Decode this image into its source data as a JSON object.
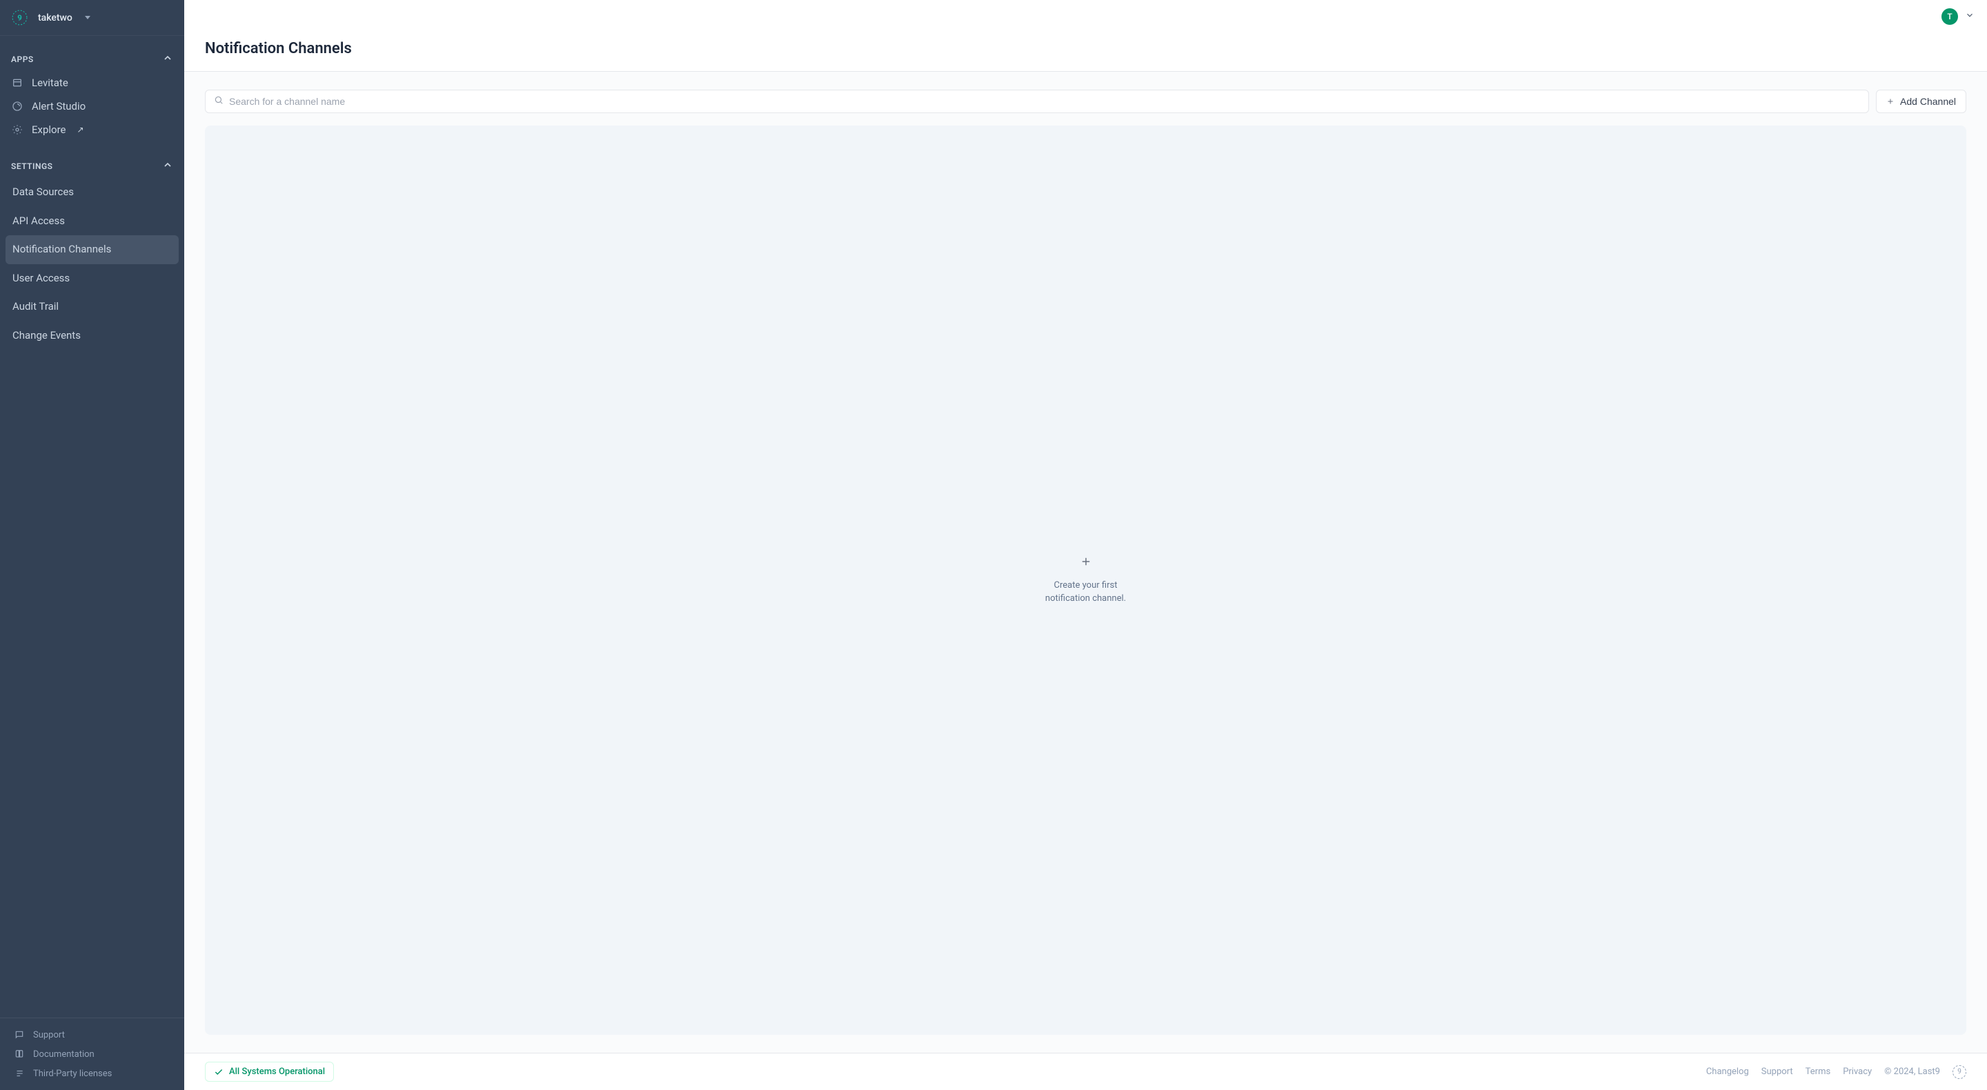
{
  "sidebar": {
    "org": "taketwo",
    "sections": {
      "apps": {
        "label": "APPS",
        "items": [
          {
            "label": "Levitate"
          },
          {
            "label": "Alert Studio"
          },
          {
            "label": "Explore"
          }
        ]
      },
      "settings": {
        "label": "SETTINGS",
        "items": [
          {
            "label": "Data Sources"
          },
          {
            "label": "API Access"
          },
          {
            "label": "Notification Channels"
          },
          {
            "label": "User Access"
          },
          {
            "label": "Audit Trail"
          },
          {
            "label": "Change Events"
          }
        ]
      }
    },
    "footer": [
      {
        "label": "Support"
      },
      {
        "label": "Documentation"
      },
      {
        "label": "Third-Party licenses"
      }
    ]
  },
  "header": {
    "avatar_initial": "T"
  },
  "page": {
    "title": "Notification Channels",
    "search_placeholder": "Search for a channel name",
    "add_button": "Add Channel",
    "empty_state": "Create your first notification channel."
  },
  "footer_bar": {
    "status": "All Systems Operational",
    "links": [
      "Changelog",
      "Support",
      "Terms",
      "Privacy"
    ],
    "copyright": "© 2024, Last9"
  }
}
